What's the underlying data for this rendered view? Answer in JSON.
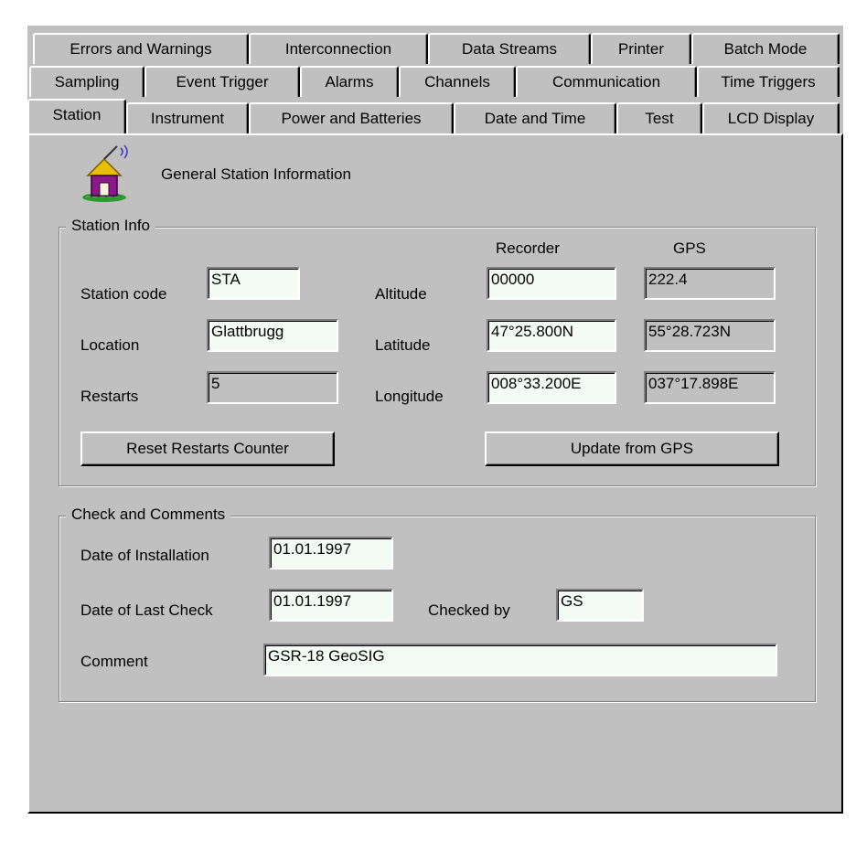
{
  "tabs": {
    "row1": [
      "Errors and Warnings",
      "Interconnection",
      "Data Streams",
      "Printer",
      "Batch Mode"
    ],
    "row2": [
      "Sampling",
      "Event Trigger",
      "Alarms",
      "Channels",
      "Communication",
      "Time Triggers"
    ],
    "row3": [
      "Station",
      "Instrument",
      "Power and Batteries",
      "Date and Time",
      "Test",
      "LCD Display"
    ]
  },
  "header": {
    "title": "General Station Information",
    "icon": "station-house-antenna-icon"
  },
  "station_info": {
    "title": "Station Info",
    "col_recorder": "Recorder",
    "col_gps": "GPS",
    "station_code_label": "Station code",
    "station_code": "STA",
    "location_label": "Location",
    "location": "Glattbrugg",
    "restarts_label": "Restarts",
    "restarts": "5",
    "altitude_label": "Altitude",
    "altitude_recorder": "00000",
    "altitude_gps": "222.4",
    "latitude_label": "Latitude",
    "latitude_recorder": "47°25.800N",
    "latitude_gps": "55°28.723N",
    "longitude_label": "Longitude",
    "longitude_recorder": "008°33.200E",
    "longitude_gps": "037°17.898E",
    "reset_button": "Reset Restarts Counter",
    "update_button": "Update from GPS"
  },
  "check": {
    "title": "Check and Comments",
    "install_label": "Date of Installation",
    "install_date": "01.01.1997",
    "last_check_label": "Date of Last Check",
    "last_check_date": "01.01.1997",
    "checked_by_label": "Checked by",
    "checked_by": "GS",
    "comment_label": "Comment",
    "comment": "GSR-18 GeoSIG"
  }
}
